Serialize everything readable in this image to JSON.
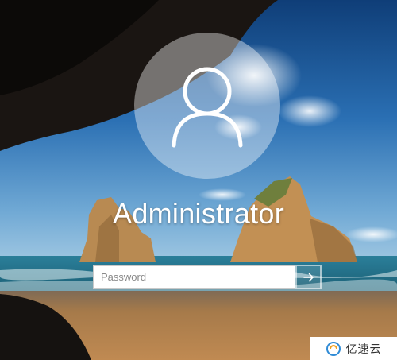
{
  "lock_screen": {
    "username": "Administrator",
    "password": {
      "placeholder": "Password",
      "value": ""
    },
    "submit_icon": "arrow-right-icon",
    "avatar_icon": "user-silhouette-icon"
  },
  "watermark": {
    "text": "亿速云",
    "logo_icon": "cloud-logo-icon"
  },
  "colors": {
    "sky": "#1f5c9e",
    "sea": "#1c6f86",
    "sand": "#a67a4a",
    "cave": "#1a1512",
    "rock": "#b98a4d"
  }
}
